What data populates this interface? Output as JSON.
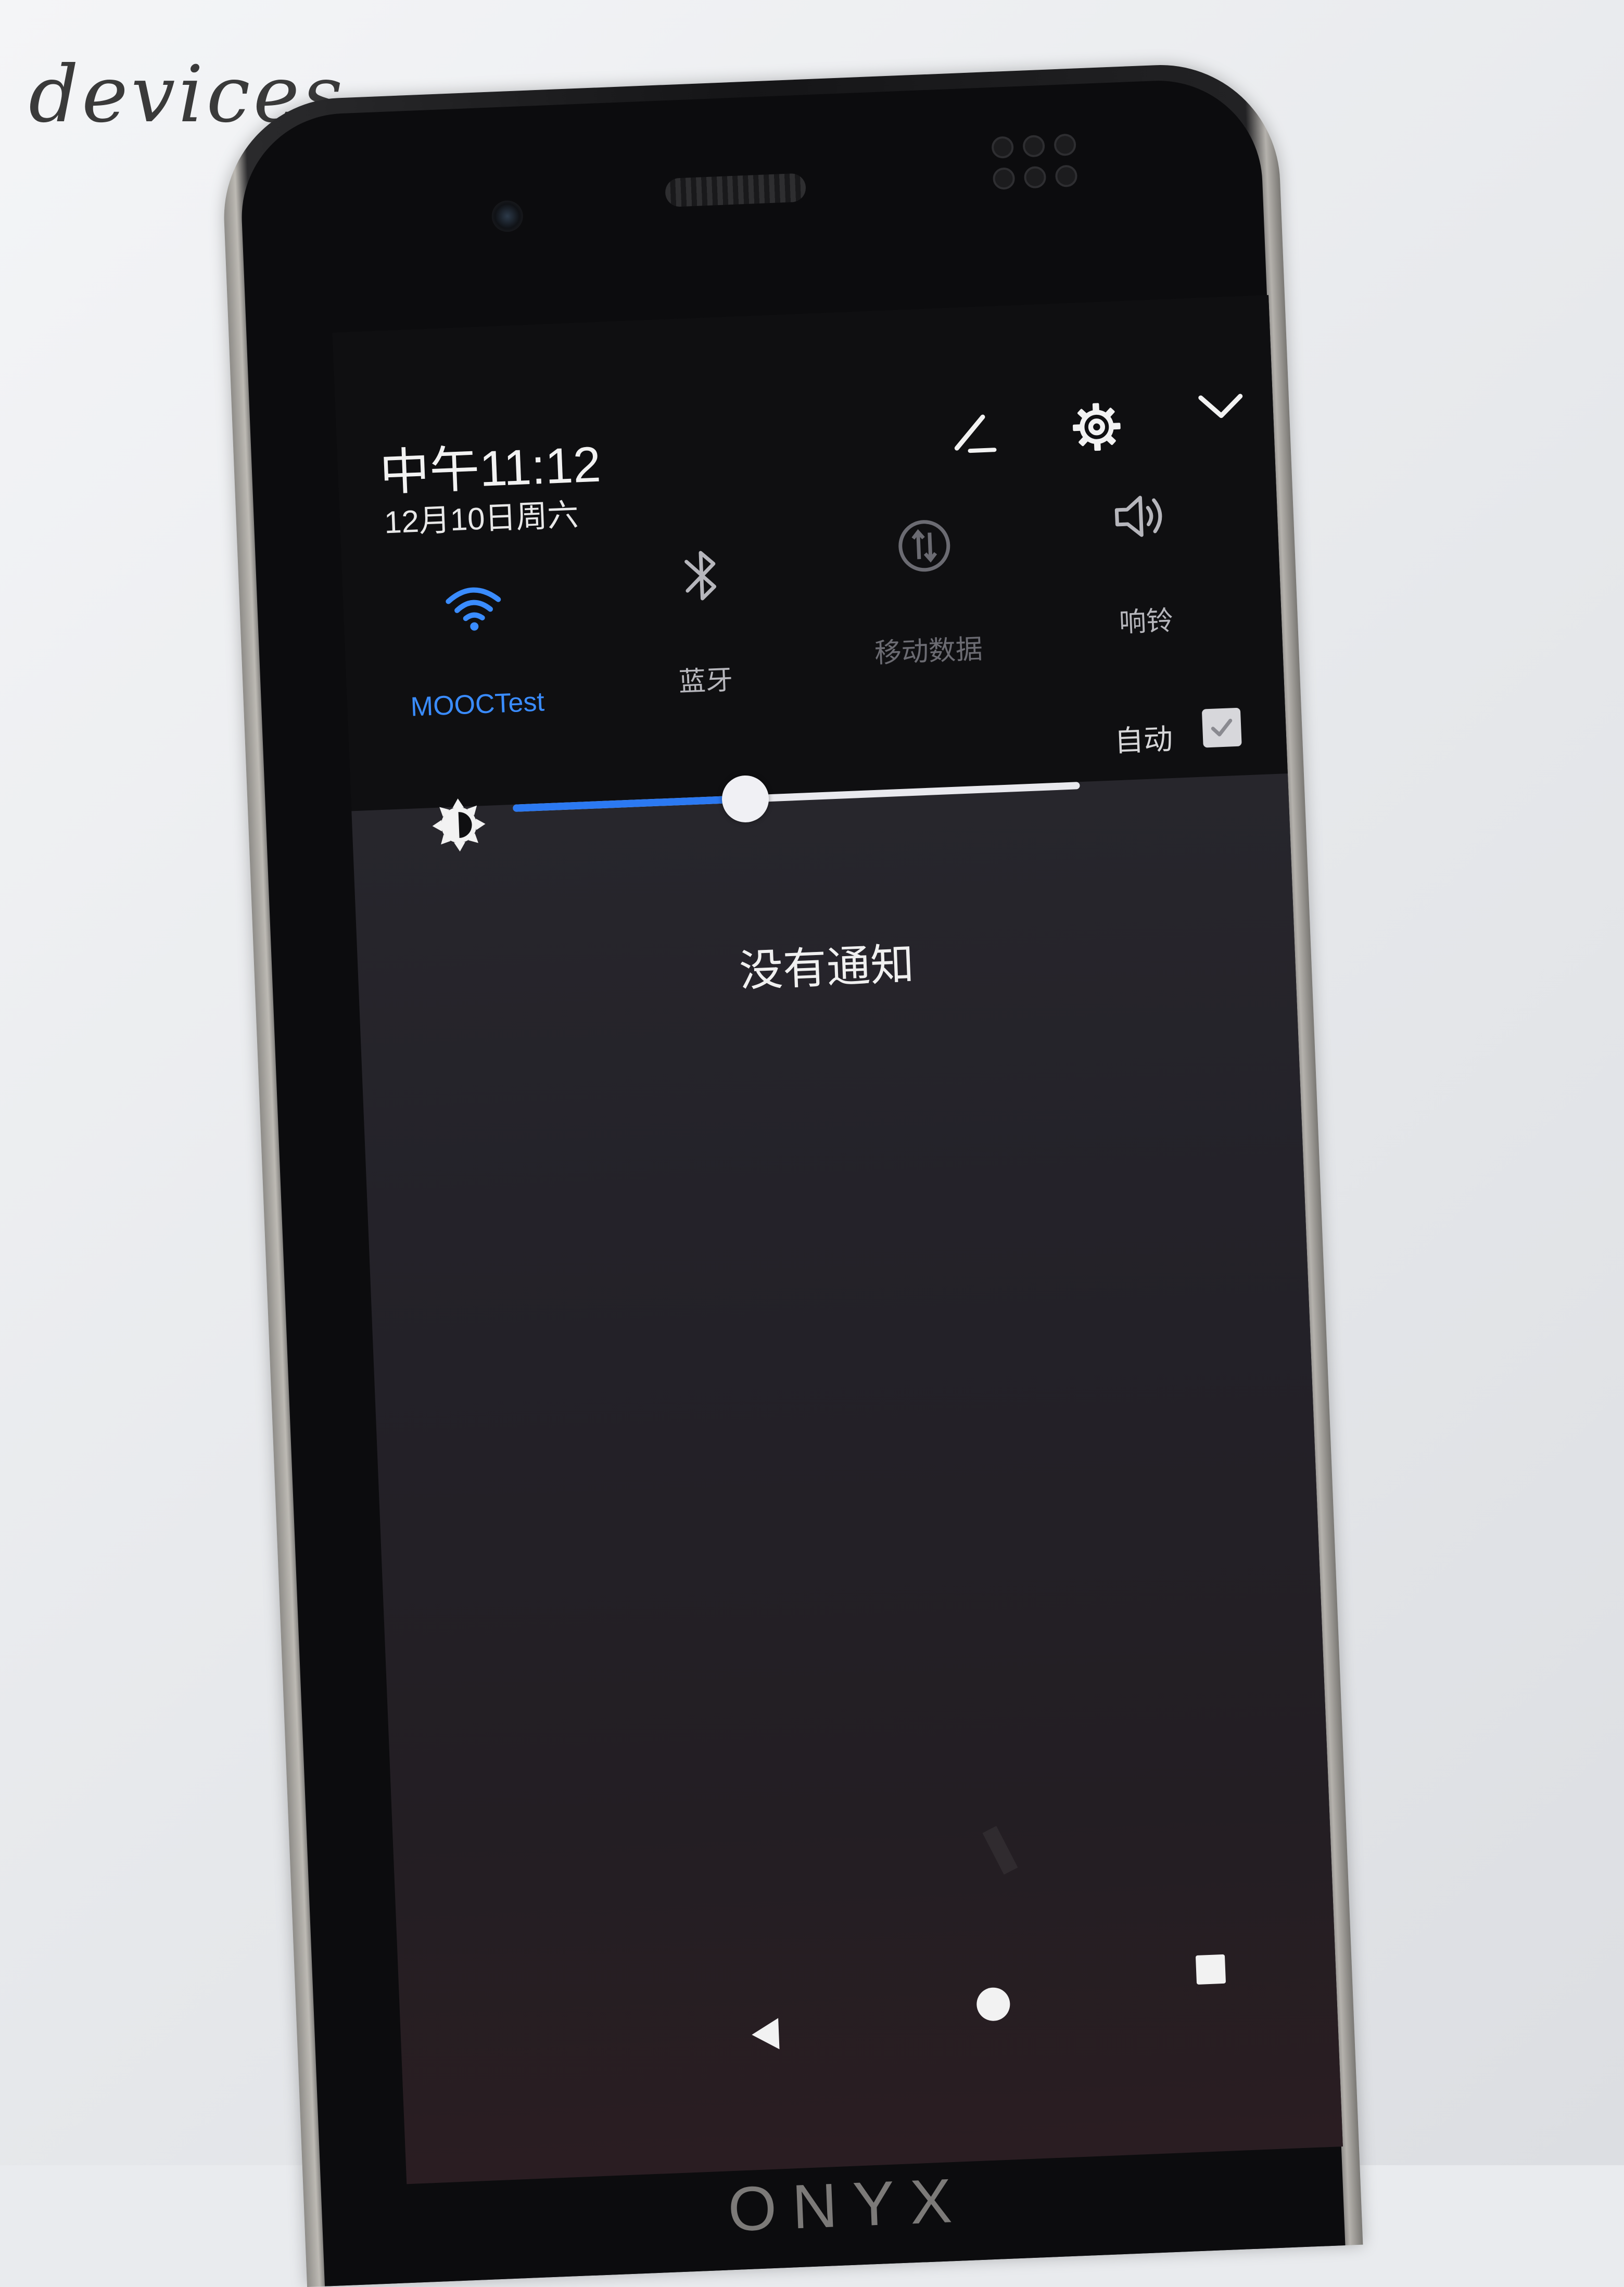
{
  "paper": {
    "handwriting": "devices"
  },
  "status": {
    "time": "中午11:12",
    "date": "12月10日周六"
  },
  "header_icons": [
    {
      "name": "edit-icon"
    },
    {
      "name": "gear-icon"
    },
    {
      "name": "chevron-down-icon"
    }
  ],
  "quick_tiles": [
    {
      "label": "MOOCTest",
      "icon": "wifi-icon",
      "active": true
    },
    {
      "label": "蓝牙",
      "icon": "bluetooth-icon",
      "active": false
    },
    {
      "label": "移动数据",
      "icon": "mobile-data-icon",
      "active": false
    },
    {
      "label": "响铃",
      "icon": "speaker-icon",
      "active": false
    }
  ],
  "brightness": {
    "level": 0.41,
    "auto_label": "自动",
    "auto_checked": true
  },
  "notifications": {
    "empty_text": "没有通知"
  },
  "navigation": {
    "buttons": [
      "back-icon",
      "home-icon",
      "recents-icon"
    ]
  },
  "brand": {
    "text": "ONYX"
  },
  "colors": {
    "accent": "#2b79f2",
    "active_tile": "#3a8cff",
    "inactive_tile": "#b6b6bc",
    "disabled_tile": "#6b6b72",
    "shade_bg": "#0f0f11",
    "notif_bg": "#252329"
  }
}
